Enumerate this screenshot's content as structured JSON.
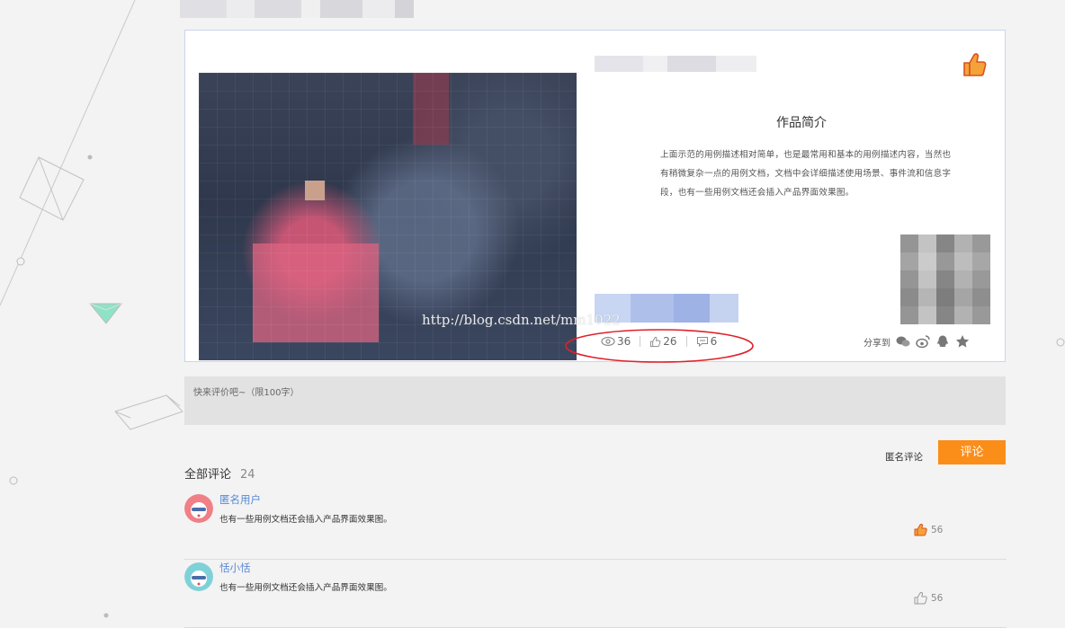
{
  "card": {
    "intro_title": "作品简介",
    "intro_body": "上面示范的用例描述相对简单，也是最常用和基本的用例描述内容，当然也有稍微复杂一点的用例文档，文档中会详细描述使用场景、事件流和信息字段，也有一些用例文档还会插入产品界面效果图。",
    "watermark": "http://blog.csdn.net/mm1022",
    "stats": {
      "views": "36",
      "likes": "26",
      "comments": "6"
    },
    "share_label": "分享到"
  },
  "comment_input": {
    "placeholder": "快来评价吧~（限100字）"
  },
  "comment_actions": {
    "anonymous_label": "匿名评论",
    "submit_label": "评论"
  },
  "comments_section": {
    "title": "全部评论",
    "count": "24",
    "items": [
      {
        "user": "匿名用户",
        "text": "也有一些用例文档还会插入产品界面效果图。",
        "likes": "56",
        "liked": true,
        "avatar_color": "#f07f86"
      },
      {
        "user": "恬小恬",
        "text": "也有一些用例文档还会插入产品界面效果图。",
        "likes": "56",
        "liked": false,
        "avatar_color": "#7fd1d8"
      }
    ]
  },
  "colors": {
    "accent_orange": "#fb8d19",
    "link_blue": "#5a88d6",
    "highlight_red": "#e0202a"
  }
}
